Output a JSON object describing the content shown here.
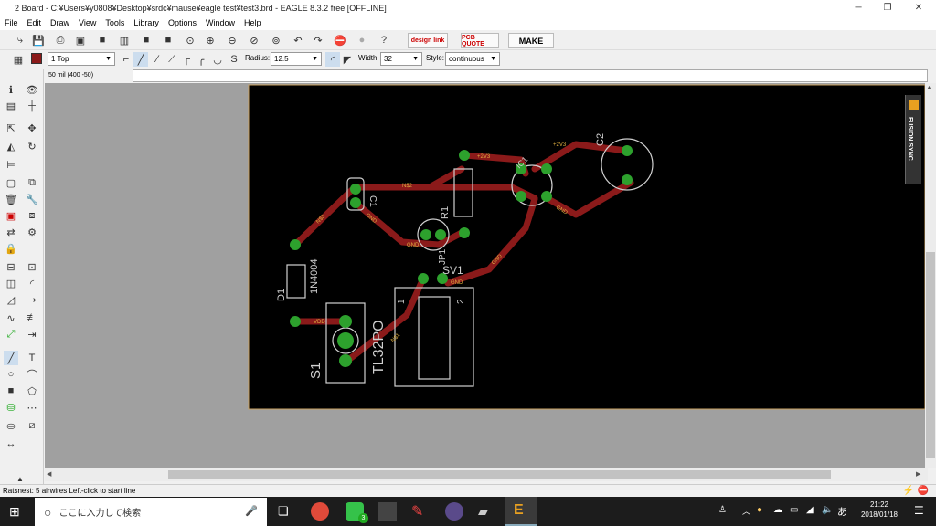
{
  "window": {
    "title": "2 Board - C:¥Users¥y0808¥Desktop¥srdc¥mause¥eagle test¥test3.brd - EAGLE 8.3.2 free [OFFLINE]"
  },
  "menu": [
    "File",
    "Edit",
    "Draw",
    "View",
    "Tools",
    "Library",
    "Options",
    "Window",
    "Help"
  ],
  "toolbar": {
    "design_link": "design link",
    "pcb_quote": "PCB QUOTE",
    "make": "MAKE"
  },
  "params": {
    "layer": "1 Top",
    "radius_label": "Radius:",
    "radius": "12.5",
    "width_label": "Width:",
    "width": "32",
    "style_label": "Style:",
    "style": "continuous"
  },
  "coord": "50 mil (400 -50)",
  "fusion": "FUSION SYNC",
  "board": {
    "parts": {
      "c1": "C1",
      "c2": "C2",
      "r1": "R1",
      "d1": "D1",
      "d1_value": "1N4004",
      "s1": "S1",
      "s1_value": "TL32PO",
      "jp1": "JP1",
      "ic1": "IC1",
      "jp_value": "SV1",
      "pin1": "1",
      "pin2": "2"
    },
    "nets": {
      "n1": "N$1",
      "n2": "N$2",
      "n3": "N$3",
      "gnd": "GND",
      "v2": "+2V3",
      "vdd": "VDD"
    }
  },
  "status": "Ratsnest: 5 airwires Left-click to start line",
  "taskbar": {
    "search": "ここに入力して検索",
    "time": "21:22",
    "date": "2018/01/18",
    "badge": "3",
    "ime": "あ"
  },
  "colors": {
    "pcb_bg": "#000000",
    "trace": "#8b1a1a",
    "pad": "#2da12d",
    "silk": "#d0d0d0",
    "canvas": "#a0a0a0"
  }
}
